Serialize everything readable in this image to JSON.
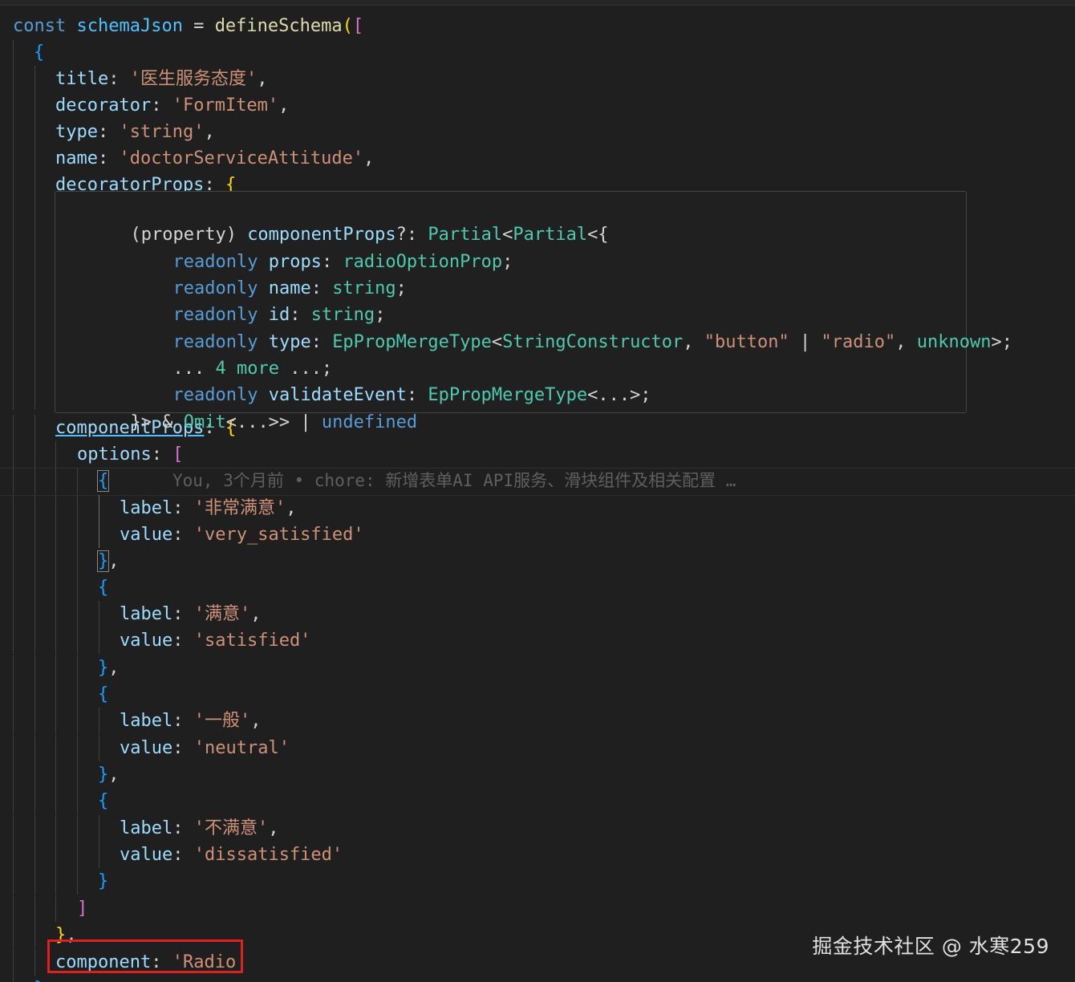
{
  "code": {
    "l1_kw": "const",
    "l1_var": "schemaJson",
    "l1_eq": " = ",
    "l1_fn": "defineSchema",
    "l1_paren": "(",
    "l1_bracket": "[",
    "l2": "{",
    "title_key": "title",
    "title_val": "'医生服务态度'",
    "decorator_key": "decorator",
    "decorator_val": "'FormItem'",
    "type_key": "type",
    "type_val": "'string'",
    "name_key": "name",
    "name_val": "'doctorServiceAttitude'",
    "decoratorProps_key": "decoratorProps",
    "componentProps_key": "componentProps",
    "options_key": "options",
    "label_key": "label",
    "value_key": "value",
    "opt1_label": "'非常满意'",
    "opt1_value": "'very_satisfied'",
    "opt2_label": "'满意'",
    "opt2_value": "'satisfied'",
    "opt3_label": "'一般'",
    "opt3_value": "'neutral'",
    "opt4_label": "'不满意'",
    "opt4_value": "'dissatisfied'",
    "component_key": "component",
    "component_val": "'Radio"
  },
  "blame": "You, 3个月前 • chore: 新增表单AI API服务、滑块组件及相关配置 …",
  "hover": {
    "l1_a": "(property) ",
    "l1_b": "componentProps",
    "l1_c": "?: ",
    "l1_d": "Partial",
    "l1_e": "<",
    "l1_f": "Partial",
    "l1_g": "<{",
    "readonly": "readonly",
    "props_key": "props",
    "props_type": "radioOptionProp",
    "name_key": "name",
    "string": "string",
    "id_key": "id",
    "type_key": "type",
    "ep_type": "EpPropMergeType",
    "string_ctor": "StringConstructor",
    "button_lit": "\"button\"",
    "radio_lit": "\"radio\"",
    "unknown": "unknown",
    "more_a": "... ",
    "more_b": "4 more",
    "more_c": " ...;",
    "validate_key": "validateEvent",
    "ep_type2": "EpPropMergeType",
    "ellipsis_generic": "<...>;",
    "end_a": "}> & ",
    "end_omit": "Omit",
    "end_b": "<...>> | ",
    "end_undefined": "undefined"
  },
  "watermark": "掘金技术社区 @ 水寒259"
}
